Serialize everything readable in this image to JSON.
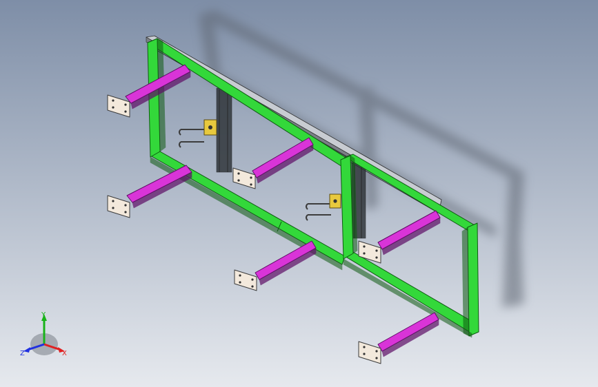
{
  "viewport": {
    "background_top": "#7e8ea7",
    "background_bottom": "#e6e9ee"
  },
  "model": {
    "frame_color": "#33d83a",
    "frame_edge": "#0f5a12",
    "arm_color": "#d934d8",
    "arm_edge": "#5e0e66",
    "plate_color": "#f3e9dc",
    "bracket_color": "#e8c93e",
    "rail_color": "#c8ccd2",
    "shadow_color": "#5f6672"
  },
  "triad": {
    "x_label": "X",
    "y_label": "Y",
    "z_label": "Z",
    "x_color": "#e02020",
    "y_color": "#19b319",
    "z_color": "#2030e0"
  }
}
